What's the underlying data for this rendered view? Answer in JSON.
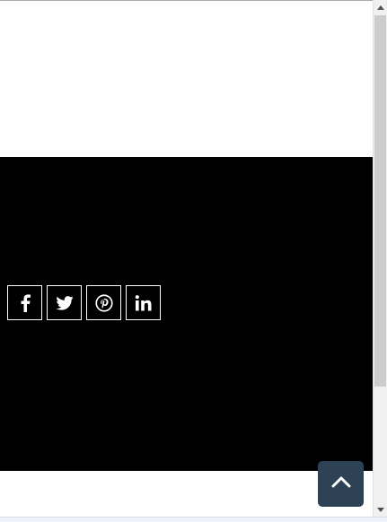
{
  "social": {
    "items": [
      {
        "name": "facebook",
        "icon": "facebook-icon"
      },
      {
        "name": "twitter",
        "icon": "twitter-icon"
      },
      {
        "name": "pinterest",
        "icon": "pinterest-icon"
      },
      {
        "name": "linkedin",
        "icon": "linkedin-icon"
      }
    ]
  },
  "back_to_top": {
    "icon": "chevron-up-icon"
  },
  "colors": {
    "footer_bg": "#000000",
    "back_to_top_bg": "#2e4256",
    "icon_color": "#ffffff"
  },
  "scrollbar": {
    "position": 0.74
  }
}
